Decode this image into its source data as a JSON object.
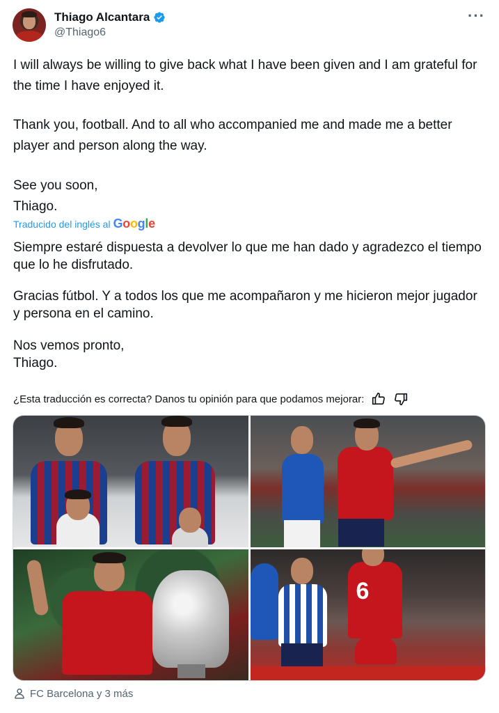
{
  "author": {
    "display_name": "Thiago Alcantara",
    "handle": "@Thiago6",
    "verified_icon": "verified-badge-icon",
    "more_label": "···"
  },
  "tweet": {
    "paragraphs": [
      "I will always be willing to give back what I have been given and I am grateful for the time I have enjoyed it.",
      "Thank you, football. And to all who accompanied me and made me a better player and person along the way.",
      "See you soon,\nThiago."
    ]
  },
  "translation": {
    "label": "Traducido del inglés al",
    "provider": "Google",
    "paragraphs": [
      "Siempre estaré dispuesta a devolver lo que me han dado y agradezco el tiempo que lo he disfrutado.",
      "Gracias fútbol. Y a todos los que me acompañaron y me hicieron mejor jugador y persona en el camino.",
      "Nos vemos pronto,\nThiago."
    ],
    "feedback_prompt": "¿Esta traducción es correcta? Danos tu opinión para que podamos mejorar:"
  },
  "media": {
    "photos": [
      {
        "name": "photo-barcelona-lineup"
      },
      {
        "name": "photo-spain-celebration"
      },
      {
        "name": "photo-bayern-trophy"
      },
      {
        "name": "photo-liverpool-match"
      }
    ]
  },
  "tagged": {
    "text": "FC Barcelona y 3 más",
    "icon": "person-icon"
  },
  "colors": {
    "link_blue": "#1d9bf0",
    "secondary_text": "#536471",
    "primary_text": "#0f1419"
  }
}
